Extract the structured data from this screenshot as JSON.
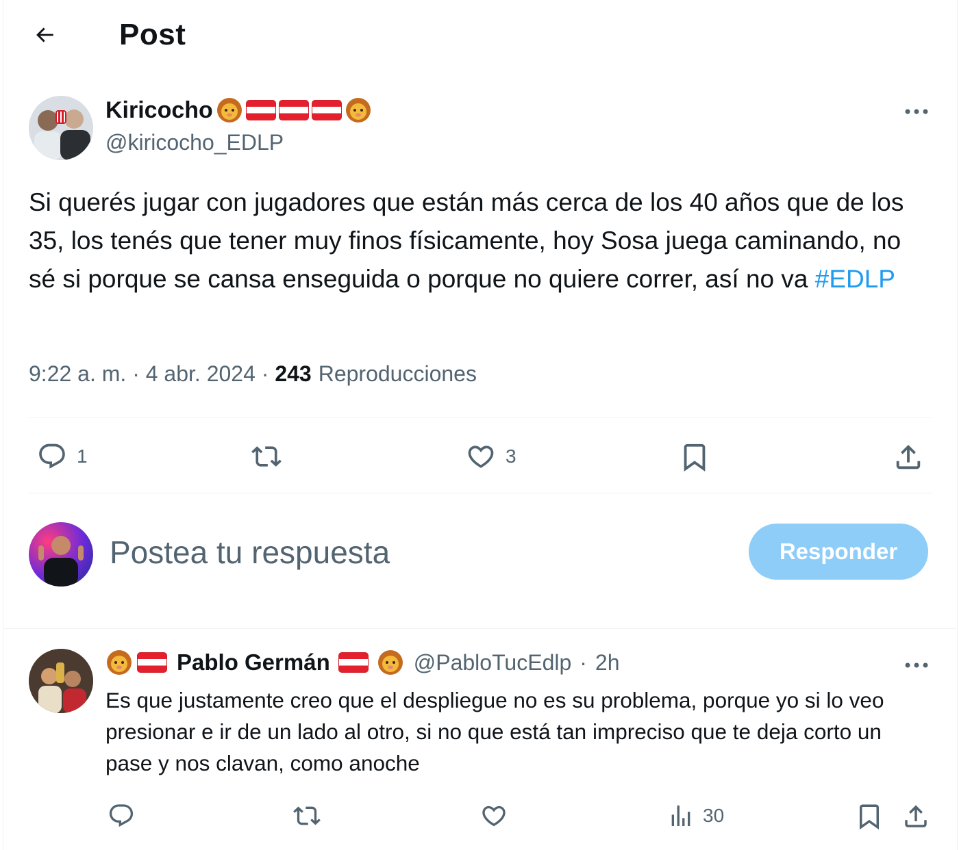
{
  "header": {
    "title": "Post",
    "back_icon": "arrow-left-icon"
  },
  "tweet": {
    "author_name": "Kiricocho",
    "author_handle": "@kiricocho_EDLP",
    "text_before_hashtag": "Si querés jugar con jugadores que están más cerca de los 40 años que de los 35, los tenés que tener muy finos físicamente, hoy Sosa juega caminando, no sé si porque se cansa enseguida o porque no quiere correr, así no va ",
    "hashtag": "#EDLP",
    "time": "9:22 a. m.",
    "sep1": " · ",
    "date": "4 abr. 2024",
    "sep2": " · ",
    "views_count": "243",
    "views_label": "Reproducciones",
    "actions": {
      "reply_count": "1",
      "retweet_count": "",
      "like_count": "3"
    }
  },
  "composer": {
    "placeholder": "Postea tu respuesta",
    "button_label": "Responder"
  },
  "reply": {
    "author_name": "Pablo Germán",
    "author_handle": "@PabloTucEdlp",
    "dot": "·",
    "time": "2h",
    "text": "Es que justamente creo que el despliegue no es su problema, porque yo si lo veo presionar e ir de un lado al otro, si no que está tan impreciso que te deja corto un pase y nos clavan, como anoche",
    "views_count": "30"
  },
  "colors": {
    "link": "#1d9bf0",
    "secondary_text": "#536471",
    "primary_text": "#0f1419",
    "button_disabled": "#8ecdf8"
  }
}
